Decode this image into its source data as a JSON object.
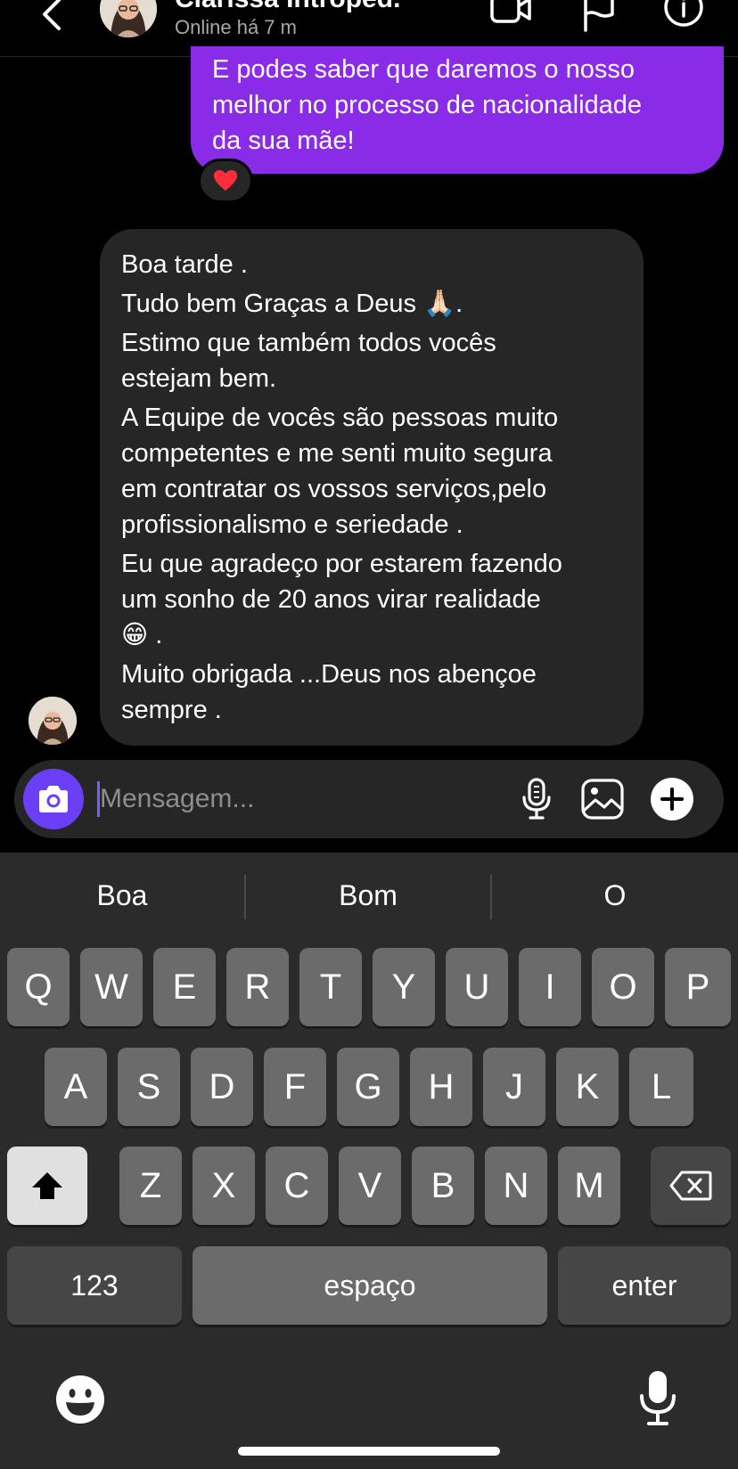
{
  "header": {
    "name": "Clarissa Introped.",
    "status": "Online há 7 m",
    "icons": [
      "chevron-left-icon",
      "video-call-icon",
      "flag-icon",
      "info-icon"
    ]
  },
  "messages": {
    "outgoing": {
      "lines": [
        "E podes saber que daremos o nosso",
        "melhor no processo de nacionalidade",
        "da sua mãe!"
      ],
      "reaction": "❤️"
    },
    "incoming": {
      "paragraphs": [
        [
          "Boa tarde ."
        ],
        [
          "Tudo bem Graças a Deus 🙏🏻."
        ],
        [
          "Estimo que também todos vocês",
          "estejam bem."
        ],
        [
          "A Equipe de vocês são pessoas muito",
          "competentes e me senti muito segura",
          "em contratar os vossos serviços,pelo",
          "profissionalismo e seriedade ."
        ],
        [
          "Eu que agradeço por estarem fazendo",
          "um sonho de 20 anos virar realidade",
          "😁  ."
        ],
        [
          "Muito obrigada ...Deus nos abençoe",
          "sempre ."
        ]
      ]
    }
  },
  "composer": {
    "placeholder": "Mensagem...",
    "icons": [
      "camera-icon",
      "microphone-icon",
      "gallery-icon",
      "plus-icon"
    ]
  },
  "keyboard": {
    "suggestions": [
      "Boa",
      "Bom",
      "O"
    ],
    "row1": [
      "Q",
      "W",
      "E",
      "R",
      "T",
      "Y",
      "U",
      "I",
      "O",
      "P"
    ],
    "row2": [
      "A",
      "S",
      "D",
      "F",
      "G",
      "H",
      "J",
      "K",
      "L"
    ],
    "row3": [
      "Z",
      "X",
      "C",
      "V",
      "B",
      "N",
      "M"
    ],
    "numbers_label": "123",
    "space_label": "espaço",
    "enter_label": "enter",
    "icons": [
      "shift-icon",
      "backspace-icon",
      "emoji-icon",
      "dictation-icon"
    ]
  },
  "colors": {
    "outgoing_bubble": "#8a2be8",
    "incoming_bubble": "#262626",
    "camera_button": "#6a3ff5",
    "keyboard_bg": "#2b2b2b",
    "key_bg": "#6b6b6b"
  }
}
